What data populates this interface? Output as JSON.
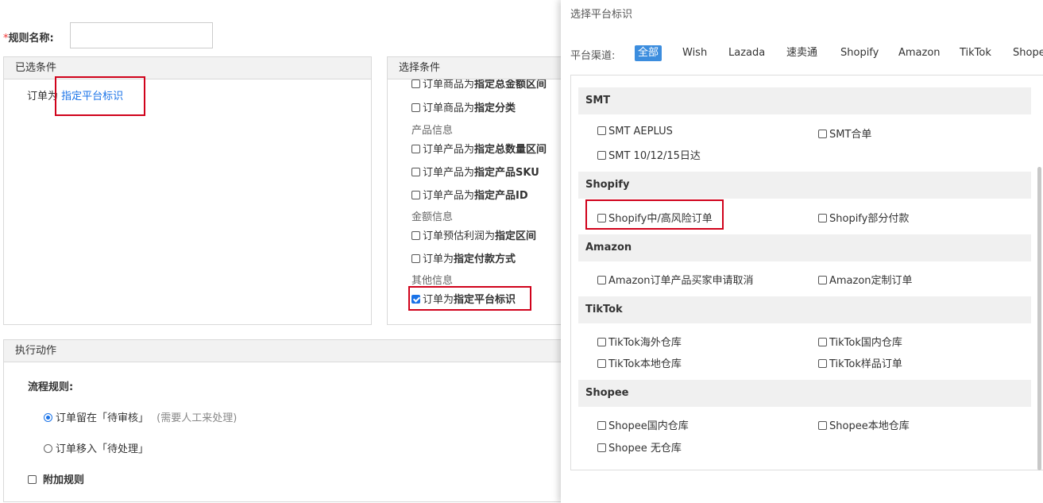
{
  "rule_name": {
    "required_mark": "*",
    "label": "规则名称:",
    "value": ""
  },
  "selected_conditions": {
    "title": "已选条件",
    "prefix": "订单为",
    "link": "指定平台标识"
  },
  "choose_conditions": {
    "title": "选择条件",
    "items": [
      {
        "pre": "订单商品为",
        "bold": "指定总金额区间",
        "checked": false
      },
      {
        "pre": "订单商品为",
        "bold": "指定分类",
        "checked": false
      },
      {
        "group": "产品信息"
      },
      {
        "pre": "订单产品为",
        "bold": "指定总数量区间",
        "checked": false
      },
      {
        "pre": "订单产品为",
        "bold": "指定产品SKU",
        "checked": false
      },
      {
        "pre": "订单产品为",
        "bold": "指定产品ID",
        "checked": false
      },
      {
        "group": "金额信息"
      },
      {
        "pre": "订单预估利润为",
        "bold": "指定区间",
        "checked": false
      },
      {
        "pre": "订单为",
        "bold": "指定付款方式",
        "checked": false
      },
      {
        "group": "其他信息"
      },
      {
        "pre": "订单为",
        "bold": "指定平台标识",
        "checked": true
      }
    ]
  },
  "actions": {
    "title": "执行动作",
    "flow_label": "流程规则:",
    "radio1": {
      "label": "订单留在「待审核」",
      "note": "(需要人工来处理)",
      "selected": true
    },
    "radio2": {
      "label": "订单移入「待处理」",
      "selected": false
    },
    "extra_label": "附加规则"
  },
  "drawer": {
    "title": "选择平台标识",
    "channel_label": "平台渠道:",
    "tabs": [
      "全部",
      "Wish",
      "Lazada",
      "速卖通",
      "Shopify",
      "Amazon",
      "TikTok",
      "Shope"
    ],
    "active_tab": 0,
    "sections": [
      {
        "name": "SMT",
        "options": [
          "SMT AEPLUS",
          "SMT合单",
          "SMT 10/12/15日达"
        ]
      },
      {
        "name": "Shopify",
        "options": [
          "Shopify中/高风险订单",
          "Shopify部分付款"
        ]
      },
      {
        "name": "Amazon",
        "options": [
          "Amazon订单产品买家申请取消",
          "Amazon定制订单"
        ]
      },
      {
        "name": "TikTok",
        "options": [
          "TikTok海外仓库",
          "TikTok国内仓库",
          "TikTok本地仓库",
          "TikTok样品订单"
        ]
      },
      {
        "name": "Shopee",
        "options": [
          "Shopee国内仓库",
          "Shopee本地仓库",
          "Shopee 无仓库"
        ]
      }
    ]
  }
}
